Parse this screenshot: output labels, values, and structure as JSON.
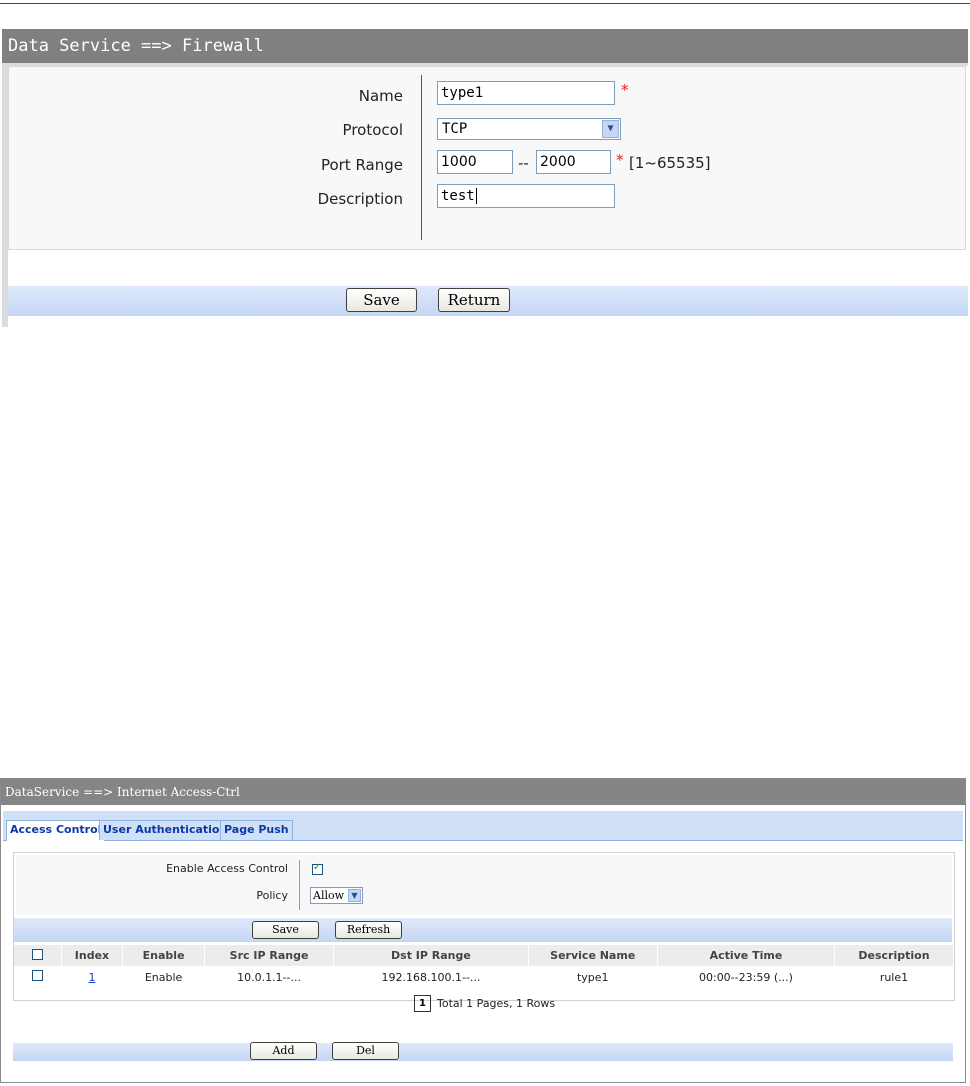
{
  "firewall": {
    "title": "Data Service ==> Firewall",
    "fields": {
      "name_label": "Name",
      "name_value": "type1",
      "protocol_label": "Protocol",
      "protocol_value": "TCP",
      "port_label": "Port Range",
      "port_from": "1000",
      "port_sep": "--",
      "port_to": "2000",
      "port_hint": "[1~65535]",
      "desc_label": "Description",
      "desc_value": "test"
    },
    "required_mark": "*",
    "buttons": {
      "save": "Save",
      "return": "Return"
    }
  },
  "access_ctrl": {
    "title": "DataService ==> Internet Access-Ctrl",
    "tabs": [
      {
        "label": "Access Control",
        "active": true
      },
      {
        "label": "User Authentication",
        "active": false
      },
      {
        "label": "Page Push",
        "active": false
      }
    ],
    "enable_label": "Enable Access Control",
    "enable_checked": true,
    "policy_label": "Policy",
    "policy_value": "Allow",
    "buttons": {
      "save": "Save",
      "refresh": "Refresh",
      "add": "Add",
      "del": "Del"
    },
    "table": {
      "headers": [
        "Index",
        "Enable",
        "Src IP Range",
        "Dst IP Range",
        "Service Name",
        "Active Time",
        "Description"
      ],
      "rows": [
        [
          "1",
          "Enable",
          "10.0.1.1--...",
          "192.168.100.1--...",
          "type1",
          "00:00--23:59 (...)",
          "rule1"
        ]
      ]
    },
    "pagination": {
      "current": "1",
      "summary": "Total 1 Pages, 1 Rows"
    }
  }
}
